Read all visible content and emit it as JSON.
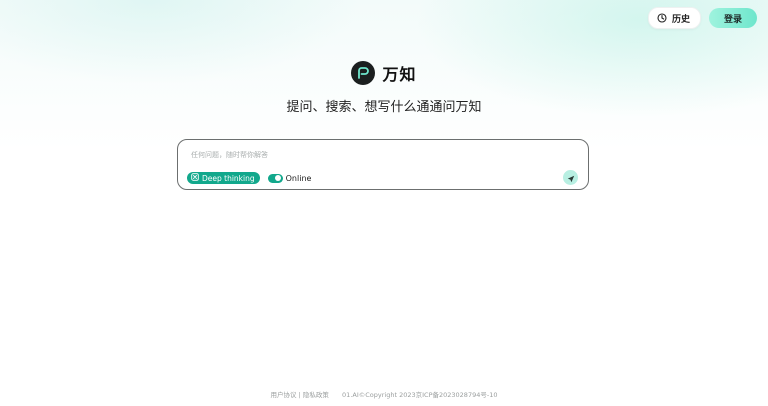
{
  "header": {
    "history_label": "历史",
    "login_label": "登录"
  },
  "brand": {
    "name": "万知",
    "tagline": "提问、搜索、想写什么通通问万知"
  },
  "search": {
    "placeholder": "任何问题，随时帮你解答",
    "value": "",
    "deep_thinking_label": "Deep thinking",
    "online_label": "Online",
    "online_enabled": true
  },
  "footer": {
    "user_agreement": "用户协议",
    "separator": "|",
    "privacy_policy": "隐私政策",
    "copyright": "01.AI©Copyright 2023京ICP备2023028794号-10"
  },
  "colors": {
    "accent": "#12a88c",
    "login_button": "#8ef0d8",
    "logo_bg": "#1b1f1f"
  }
}
